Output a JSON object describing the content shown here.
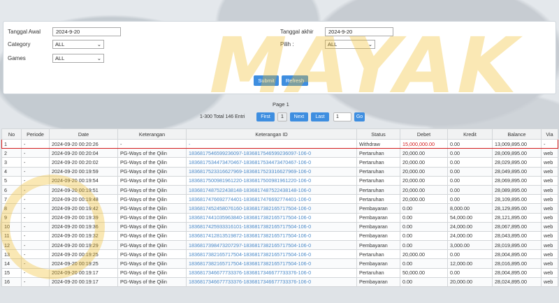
{
  "filters": {
    "tanggal_awal_label": "Tanggal Awal",
    "tanggal_awal_value": "2024-9-20",
    "tanggal_akhir_label": "Tanggal akhir",
    "tanggal_akhir_value": "2024-9-20",
    "category_label": "Category",
    "category_value": "ALL",
    "pilih_label": "Pilih  :",
    "pilih_value": "ALL",
    "games_label": "Games",
    "games_value": "ALL",
    "submit_label": "Submit",
    "refresh_label": "Refresh"
  },
  "pagination": {
    "page_label": "Page 1",
    "total_text": "1-300 Total 146 Entri",
    "first_label": "First",
    "current_page": "1",
    "next_label": "Next",
    "last_label": "Last",
    "goto_value": "1",
    "go_label": "Go"
  },
  "table": {
    "headers": [
      "No",
      "Periode",
      "Date",
      "Keterangan",
      "Keterangan ID",
      "Status",
      "Debet",
      "Kredit",
      "Balance",
      "Via"
    ],
    "rows": [
      [
        "1",
        "-",
        "2024-09-20 00:20:26",
        "-",
        "-",
        "Withdraw",
        "15,000,000.00",
        "0.00",
        "13,009,895.00",
        "-"
      ],
      [
        "2",
        "-",
        "2024-09-20 00:20:04",
        "PG-Ways of the Qilin",
        "1836817546599236097-1836817546599236097-106-0",
        "Pertaruhan",
        "20,000.00",
        "0.00",
        "28,009,895.00",
        "web"
      ],
      [
        "3",
        "-",
        "2024-09-20 00:20:02",
        "PG-Ways of the Qilin",
        "1836817534473470467-1836817534473470467-106-0",
        "Pertaruhan",
        "20,000.00",
        "0.00",
        "28,029,895.00",
        "web"
      ],
      [
        "4",
        "-",
        "2024-09-20 00:19:59",
        "PG-Ways of the Qilin",
        "1836817523316627969-1836817523316627969-106-0",
        "Pertaruhan",
        "20,000.00",
        "0.00",
        "28,049,895.00",
        "web"
      ],
      [
        "5",
        "-",
        "2024-09-20 00:19:54",
        "PG-Ways of the Qilin",
        "1836817500981961220-1836817500981961220-106-0",
        "Pertaruhan",
        "20,000.00",
        "0.00",
        "28,069,895.00",
        "web"
      ],
      [
        "6",
        "-",
        "2024-09-20 00:19:51",
        "PG-Ways of the Qilin",
        "1836817487522438148-1836817487522438148-106-0",
        "Pertaruhan",
        "20,000.00",
        "0.00",
        "28,089,895.00",
        "web"
      ],
      [
        "7",
        "-",
        "2024-09-20 00:19:48",
        "PG-Ways of the Qilin",
        "1836817476692774401-1836817476692774401-106-0",
        "Pertaruhan",
        "20,000.00",
        "0.00",
        "28,109,895.00",
        "web"
      ],
      [
        "8",
        "-",
        "2024-09-20 00:19:42",
        "PG-Ways of the Qilin",
        "1836817452458076160-1836817382165717504-106-0",
        "Pembayaran",
        "0.00",
        "8,000.00",
        "28,129,895.00",
        "web"
      ],
      [
        "9",
        "-",
        "2024-09-20 00:19:39",
        "PG-Ways of the Qilin",
        "1836817441035963840-1836817382165717504-106-0",
        "Pembayaran",
        "0.00",
        "54,000.00",
        "28,121,895.00",
        "web"
      ],
      [
        "10",
        "-",
        "2024-09-20 00:19:36",
        "PG-Ways of the Qilin",
        "1836817425933316101-1836817382165717504-106-0",
        "Pembayaran",
        "0.00",
        "24,000.00",
        "28,067,895.00",
        "web"
      ],
      [
        "11",
        "-",
        "2024-09-20 00:19:32",
        "PG-Ways of the Qilin",
        "1836817412813519872-1836817382165717504-106-0",
        "Pembayaran",
        "0.00",
        "24,000.00",
        "28,043,895.00",
        "web"
      ],
      [
        "12",
        "-",
        "2024-09-20 00:19:29",
        "PG-Ways of the Qilin",
        "1836817398473207297-1836817382165717504-106-0",
        "Pembayaran",
        "0.00",
        "3,000.00",
        "28,019,895.00",
        "web"
      ],
      [
        "13",
        "-",
        "2024-09-20 00:19:25",
        "PG-Ways of the Qilin",
        "1836817382165717504-1836817382165717504-106-0",
        "Pertaruhan",
        "20,000.00",
        "0.00",
        "28,004,895.00",
        "web"
      ],
      [
        "14",
        "-",
        "2024-09-20 00:19:25",
        "PG-Ways of the Qilin",
        "1836817382165717504-1836817382165717504-106-0",
        "Pembayaran",
        "0.00",
        "12,000.00",
        "28,016,895.00",
        "web"
      ],
      [
        "15",
        "-",
        "2024-09-20 00:19:17",
        "PG-Ways of the Qilin",
        "1836817346677733376-1836817346677733376-106-0",
        "Pertaruhan",
        "50,000.00",
        "0.00",
        "28,004,895.00",
        "web"
      ],
      [
        "16",
        "-",
        "2024-09-20 00:19:17",
        "PG-Ways of the Qilin",
        "1836817346677733376-1836817346677733376-106-0",
        "Pembayaran",
        "0.00",
        "20,000.00",
        "28,024,895.00",
        "web"
      ]
    ]
  },
  "watermark": "MAYAK",
  "colors": {
    "accent": "#3e8ee0",
    "highlight": "#d21a1a",
    "link": "#4b89c8",
    "watermark": "#f0be28"
  }
}
